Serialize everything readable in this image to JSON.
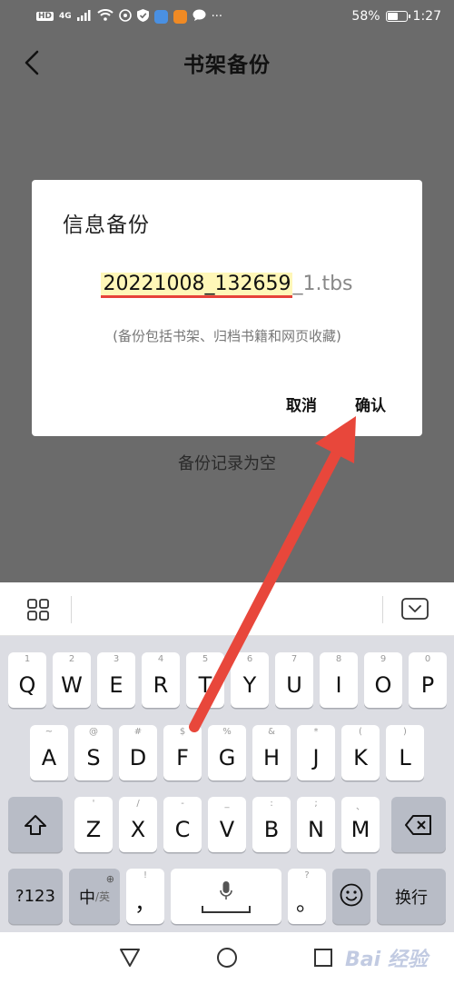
{
  "status_bar": {
    "network": "HD",
    "signal": "4G",
    "battery_percent": "58%",
    "time": "1:27",
    "more": "···"
  },
  "header": {
    "title": "书架备份"
  },
  "main": {
    "empty_text": "备份记录为空"
  },
  "dialog": {
    "title": "信息备份",
    "filename": "20221008_132659",
    "filename_suffix": "_1.tbs",
    "note": "(备份包括书架、归档书籍和网页收藏)",
    "cancel_label": "取消",
    "confirm_label": "确认"
  },
  "keyboard": {
    "row1": [
      {
        "hint": "1",
        "key": "Q"
      },
      {
        "hint": "2",
        "key": "W"
      },
      {
        "hint": "3",
        "key": "E"
      },
      {
        "hint": "4",
        "key": "R"
      },
      {
        "hint": "5",
        "key": "T"
      },
      {
        "hint": "6",
        "key": "Y"
      },
      {
        "hint": "7",
        "key": "U"
      },
      {
        "hint": "8",
        "key": "I"
      },
      {
        "hint": "9",
        "key": "O"
      },
      {
        "hint": "0",
        "key": "P"
      }
    ],
    "row2": [
      {
        "hint": "~",
        "key": "A"
      },
      {
        "hint": "@",
        "key": "S"
      },
      {
        "hint": "#",
        "key": "D"
      },
      {
        "hint": "$",
        "key": "F"
      },
      {
        "hint": "%",
        "key": "G"
      },
      {
        "hint": "&",
        "key": "H"
      },
      {
        "hint": "*",
        "key": "J"
      },
      {
        "hint": "(",
        "key": "K"
      },
      {
        "hint": ")",
        "key": "L"
      }
    ],
    "row3": [
      {
        "hint": "'",
        "key": "Z"
      },
      {
        "hint": "/",
        "key": "X"
      },
      {
        "hint": "-",
        "key": "C"
      },
      {
        "hint": "_",
        "key": "V"
      },
      {
        "hint": ":",
        "key": "B"
      },
      {
        "hint": ";",
        "key": "N"
      },
      {
        "hint": "、",
        "key": "M"
      }
    ],
    "symbols_key": "?123",
    "lang_key_main": "中",
    "lang_key_sub": "/英",
    "comma_hint": "!",
    "comma_key": "，",
    "period_hint": "?",
    "period_key": "。",
    "enter_key": "换行"
  },
  "watermark": "Bai 经验",
  "colors": {
    "annotation_arrow": "#e8473b",
    "filename_highlight": "#fff7b8",
    "filename_underline": "#e7423a"
  }
}
